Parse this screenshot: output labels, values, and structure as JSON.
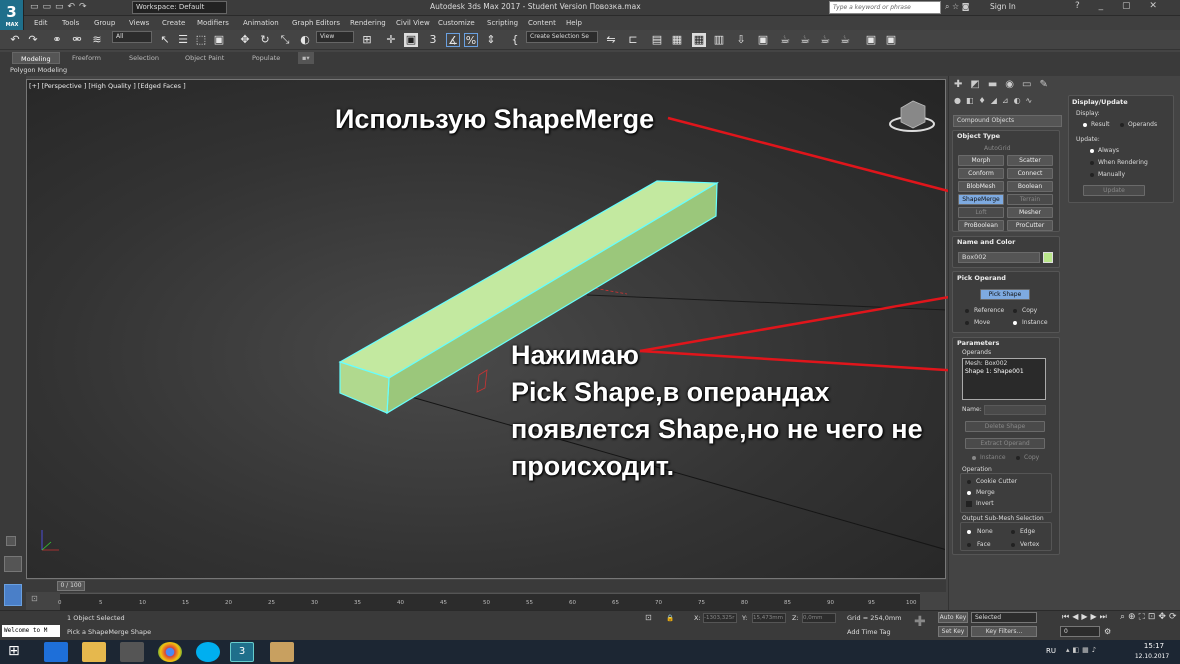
{
  "app": {
    "logo": "3",
    "logo_sub": "MAX",
    "workspace": "Workspace: Default",
    "title": "Autodesk 3ds Max 2017 - Student Version   Повозка.max",
    "search_placeholder": "Type a keyword or phrase",
    "sign_in": "Sign In"
  },
  "menu": [
    "Edit",
    "Tools",
    "Group",
    "Views",
    "Create",
    "Modifiers",
    "Animation",
    "Graph Editors",
    "Rendering",
    "Civil View",
    "Customize",
    "Scripting",
    "Content",
    "Help"
  ],
  "toolbar": {
    "filter": "All",
    "view": "View",
    "selection_set": "Create Selection Se"
  },
  "ribbon_tabs": [
    "Modeling",
    "Freeform",
    "Selection",
    "Object Paint",
    "Populate"
  ],
  "ribbon_sub": "Polygon Modeling",
  "viewport": {
    "label": "[+] [Perspective ] [High Quality ] [Edged Faces ]"
  },
  "annotations": {
    "top": "Использую ShapeMerge",
    "body_line1": "Нажимаю",
    "body_line2": "Pick Shape,в операндах",
    "body_line3": "появлется Shape,но не чего не",
    "body_line4": "происходит."
  },
  "command_panel": {
    "category": "Compound Objects",
    "object_type": {
      "title": "Object Type",
      "autogrid": "AutoGrid",
      "buttons": [
        "Morph",
        "Scatter",
        "Conform",
        "Connect",
        "BlobMesh",
        "Boolean",
        "ShapeMerge",
        "Terrain",
        "Loft",
        "Mesher",
        "ProBoolean",
        "ProCutter"
      ]
    },
    "name_color": {
      "title": "Name and Color",
      "name": "Box002",
      "color": "#b9e68a"
    },
    "pick_operand": {
      "title": "Pick Operand",
      "button": "Pick Shape",
      "options": [
        "Reference",
        "Copy",
        "Move",
        "Instance"
      ],
      "selected": "Instance"
    },
    "parameters": {
      "title": "Parameters",
      "operands_label": "Operands",
      "operands": [
        "Mesh: Box002",
        "Shape 1: Shape001"
      ],
      "name_label": "Name:",
      "delete_shape": "Delete Shape",
      "extract_operand": "Extract Operand",
      "instance": "Instance",
      "copy": "Copy",
      "operation_label": "Operation",
      "operations": [
        "Cookie Cutter",
        "Merge",
        "Invert"
      ],
      "output_label": "Output Sub-Mesh Selection",
      "outputs": [
        "None",
        "Edge",
        "Face",
        "Vertex"
      ]
    }
  },
  "display_update": {
    "title": "Display/Update",
    "display_label": "Display:",
    "display_options": [
      "Result",
      "Operands"
    ],
    "update_label": "Update:",
    "update_options": [
      "Always",
      "When Rendering",
      "Manually"
    ],
    "update_button": "Update"
  },
  "timeline": {
    "frame": "0 / 100",
    "ticks": [
      "0",
      "5",
      "10",
      "15",
      "20",
      "25",
      "30",
      "35",
      "40",
      "45",
      "50",
      "55",
      "60",
      "65",
      "70",
      "75",
      "80",
      "85",
      "90",
      "95",
      "100"
    ]
  },
  "status": {
    "selected": "1 Object Selected",
    "prompt": "Pick a ShapeMerge Shape",
    "welcome": "Welcome to M",
    "x": "-1303,325r",
    "y": "15,473mm",
    "z": "0,0mm",
    "grid": "Grid = 254,0mm",
    "add_time_tag": "Add Time Tag",
    "auto_key": "Auto Key",
    "set_key": "Set Key",
    "selected_dd": "Selected",
    "key_filters": "Key Filters...",
    "frame_field": "0"
  },
  "taskbar": {
    "lang": "RU",
    "time": "15:17",
    "date": "12.10.2017"
  }
}
